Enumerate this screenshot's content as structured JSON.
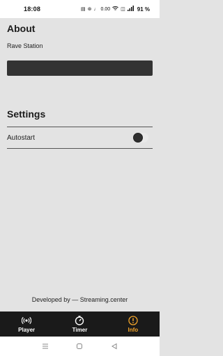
{
  "status_bar": {
    "time": "18:08",
    "icons": [
      "nfc-icon",
      "bluetooth-icon",
      "silent-icon",
      "data-speed-icon",
      "wifi-icon",
      "volte-icon",
      "signal-icon",
      "battery-icon"
    ],
    "data_speed": "0.00",
    "battery": "91 %"
  },
  "about": {
    "title": "About",
    "station_name": "Rave Station"
  },
  "settings": {
    "title": "Settings",
    "autostart_label": "Autostart",
    "autostart_enabled": false
  },
  "footer": {
    "credits": "Developed by — Streaming.center"
  },
  "bottom_nav": {
    "items": [
      {
        "label": "Player",
        "icon": "broadcast-icon",
        "active": false
      },
      {
        "label": "Timer",
        "icon": "timer-icon",
        "active": false
      },
      {
        "label": "Info",
        "icon": "info-icon",
        "active": true
      }
    ],
    "active_color": "#f2a52b"
  },
  "system_nav": {
    "buttons": [
      "menu-icon",
      "home-icon",
      "back-icon"
    ]
  }
}
